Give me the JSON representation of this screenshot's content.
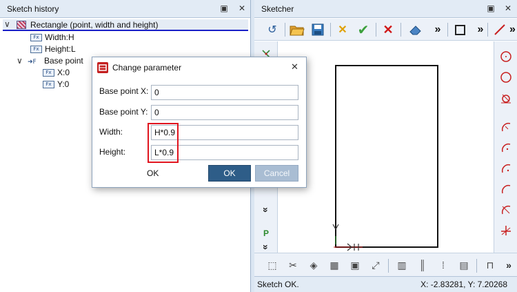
{
  "left_panel": {
    "title": "Sketch history",
    "pin_glyph": "▣",
    "close_glyph": "✕",
    "tree": {
      "root": {
        "expand_glyph": "∨",
        "label": "Rectangle (point, width and height)"
      },
      "children": [
        {
          "icon": "Fx",
          "label": "Width:H"
        },
        {
          "icon": "Fx",
          "label": "Height:L"
        }
      ],
      "base_point": {
        "expand_glyph": "∨",
        "label": "Base point",
        "icon_glyph": "➜F"
      },
      "base_children": [
        {
          "icon": "Fx",
          "label": "X:0"
        },
        {
          "icon": "Fx",
          "label": "Y:0"
        }
      ]
    }
  },
  "right_panel": {
    "title": "Sketcher",
    "pin_glyph": "▣",
    "close_glyph": "✕",
    "overflow_glyph": "»",
    "expand_down_glyph": "»",
    "side_label_p": "P",
    "status_text": "Sketch OK.",
    "coords_text": "X: -2.83281, Y: 7.20268"
  },
  "dialog": {
    "title": "Change parameter",
    "close_glyph": "✕",
    "fields": [
      {
        "label": "Base point X:",
        "value": "0"
      },
      {
        "label": "Base point Y:",
        "value": "0"
      },
      {
        "label": "Width:",
        "value": "H*0.9"
      },
      {
        "label": "Height:",
        "value": "L*0.9"
      }
    ],
    "ok_text": "OK",
    "ok_button": "OK",
    "cancel_button": "Cancel"
  },
  "colors": {
    "accent": "#2e5d88",
    "highlight_box": "#e0141e",
    "selection_underline": "#1a20c8"
  }
}
